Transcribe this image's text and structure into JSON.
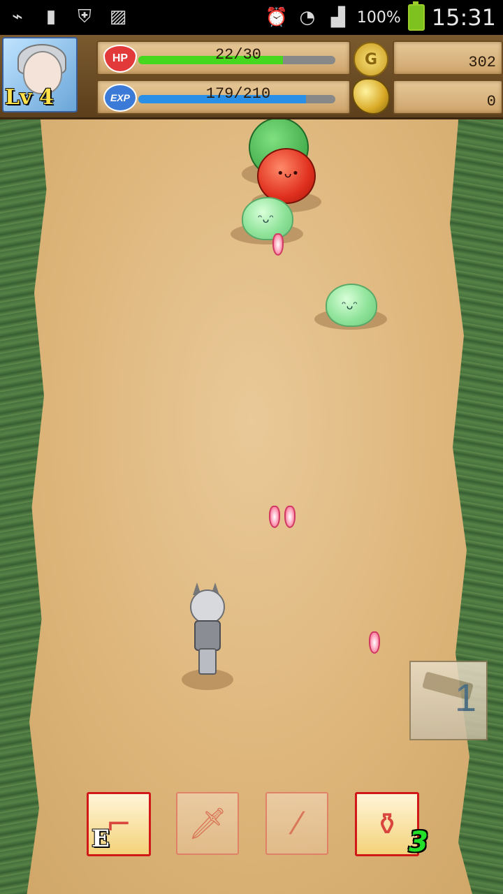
{
  "status_bar": {
    "battery_percent": "100%",
    "time": "15:31"
  },
  "hud": {
    "level": "Lv 4",
    "hp": {
      "label": "HP",
      "text": "22/30",
      "fill": 0.733,
      "color": "#45d81e"
    },
    "exp": {
      "label": "EXP",
      "text": "179/210",
      "fill": 0.852,
      "color": "#2a8fe6"
    },
    "gold": {
      "icon_label": "G",
      "value": "302"
    },
    "ore": {
      "value": "0"
    }
  },
  "ammo": {
    "count": "1"
  },
  "actions": [
    {
      "name": "gun",
      "icon": "gun-icon",
      "tag": "E",
      "active": true
    },
    {
      "name": "knife",
      "icon": "knife-icon",
      "active": false
    },
    {
      "name": "dynamite",
      "icon": "dynamite-icon",
      "active": false
    },
    {
      "name": "potion",
      "icon": "potion-icon",
      "qty": "3",
      "active": true
    }
  ]
}
